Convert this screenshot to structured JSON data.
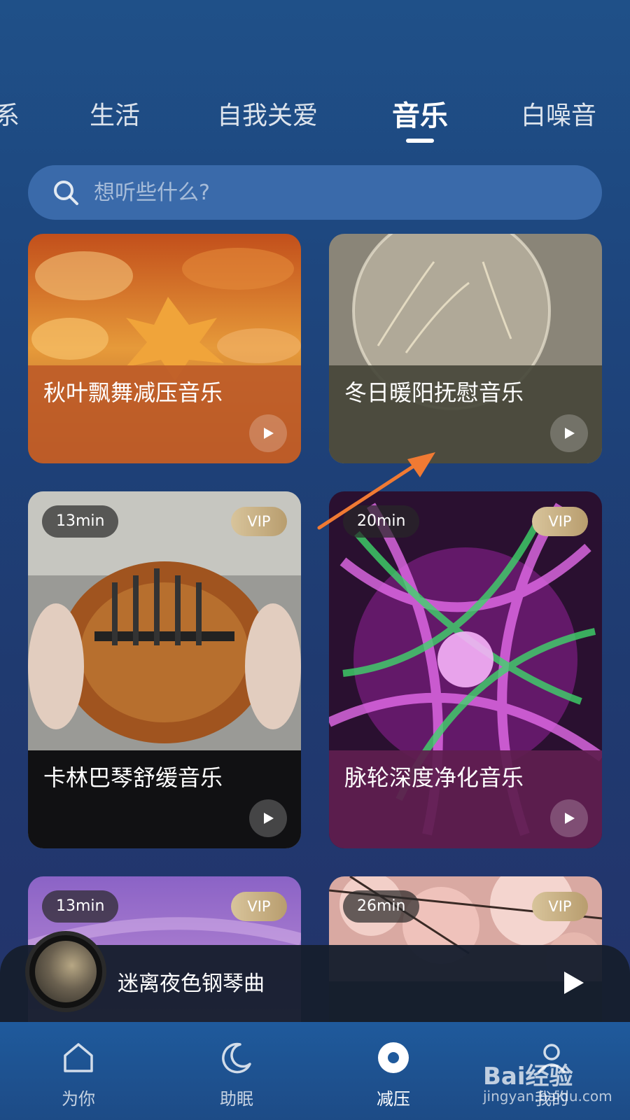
{
  "tabs": [
    "系",
    "生活",
    "自我关爱",
    "音乐",
    "白噪音"
  ],
  "search": {
    "placeholder": "想听些什么?"
  },
  "cards": [
    {
      "title": "秋叶飘舞减压音乐",
      "duration": "",
      "vip": ""
    },
    {
      "title": "冬日暖阳抚慰音乐",
      "duration": "",
      "vip": ""
    },
    {
      "title": "卡林巴琴舒缓音乐",
      "duration": "13min",
      "vip": "VIP"
    },
    {
      "title": "脉轮深度净化音乐",
      "duration": "20min",
      "vip": "VIP"
    },
    {
      "title": "",
      "duration": "13min",
      "vip": "VIP"
    },
    {
      "title": "",
      "duration": "26min",
      "vip": "VIP"
    }
  ],
  "player": {
    "title": "迷离夜色钢琴曲"
  },
  "nav": [
    "为你",
    "助眠",
    "减压",
    "我的"
  ],
  "watermark": {
    "logo": "Bai经验",
    "url": "jingyan.baidu.com"
  },
  "colors": {
    "accent": "#ffffff",
    "arrow": "#f07a33",
    "vip": "#c9b086"
  }
}
